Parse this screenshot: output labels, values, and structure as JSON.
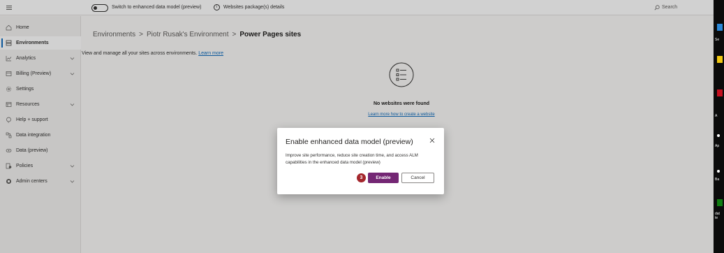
{
  "topbar": {
    "toggle_label": "Switch to enhanced data model (preview)",
    "info_label": "Websites package(s) details",
    "search_label": "Search"
  },
  "sidebar": {
    "items": [
      {
        "label": "Home",
        "icon": "home-icon",
        "chevron": false,
        "active": false
      },
      {
        "label": "Environments",
        "icon": "environments-icon",
        "chevron": false,
        "active": true
      },
      {
        "label": "Analytics",
        "icon": "analytics-icon",
        "chevron": true,
        "active": false
      },
      {
        "label": "Billing (Preview)",
        "icon": "billing-icon",
        "chevron": true,
        "active": false
      },
      {
        "label": "Settings",
        "icon": "settings-icon",
        "chevron": false,
        "active": false
      },
      {
        "label": "Resources",
        "icon": "resources-icon",
        "chevron": true,
        "active": false
      },
      {
        "label": "Help + support",
        "icon": "help-icon",
        "chevron": false,
        "active": false
      },
      {
        "label": "Data integration",
        "icon": "data-integration-icon",
        "chevron": false,
        "active": false
      },
      {
        "label": "Data (preview)",
        "icon": "data-preview-icon",
        "chevron": false,
        "active": false
      },
      {
        "label": "Policies",
        "icon": "policies-icon",
        "chevron": true,
        "active": false
      },
      {
        "label": "Admin centers",
        "icon": "admin-centers-icon",
        "chevron": true,
        "active": false
      }
    ]
  },
  "breadcrumb": {
    "items": [
      "Environments",
      "Piotr Rusak's Environment",
      "Power Pages sites"
    ],
    "separator": ">"
  },
  "main": {
    "description": "View and manage all your sites across environments.",
    "learn_more": "Learn more",
    "empty_title": "No websites were found",
    "empty_link": "Learn more how to create a website"
  },
  "dialog": {
    "title": "Enable enhanced data model (preview)",
    "body": "Improve site performance, reduce site creation time, and access ALM capabilities in the enhanced data model (preview)",
    "step_number": "3",
    "enable_label": "Enable",
    "cancel_label": "Cancel"
  },
  "desktop": {
    "labels": [
      "Se",
      "A",
      "Ap",
      "Ba",
      "dat\nte"
    ]
  },
  "colors": {
    "accent_purple": "#742774",
    "link_blue": "#0f6cbd",
    "badge_red": "#a4262c"
  }
}
